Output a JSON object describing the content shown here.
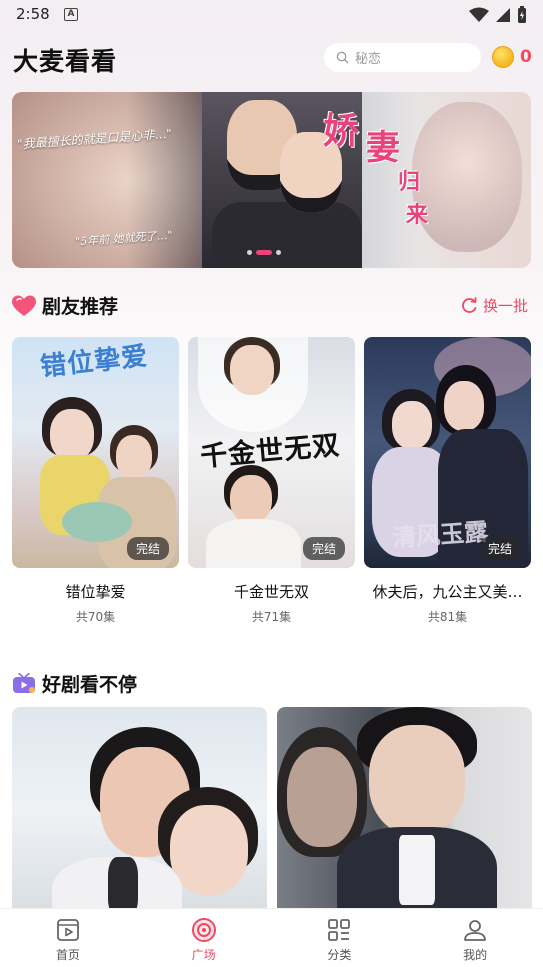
{
  "status_bar": {
    "time": "2:58",
    "notification_letter": "A"
  },
  "header": {
    "title": "大麦看看",
    "search_placeholder": "秘恋",
    "coin_count": "0"
  },
  "banner": {
    "caption_1": "\"我最擅长的就是口是心非…\"",
    "caption_2": "\"5年前 她就死了…\"",
    "title_chars": [
      "娇",
      "妻",
      "归",
      "来"
    ],
    "active_slide": 1,
    "slide_count": 3
  },
  "recommend": {
    "title": "剧友推荐",
    "refresh_label": "换一批",
    "items": [
      {
        "name": "错位挚爱",
        "episodes": "共70集",
        "badge": "完结",
        "poster_text": "错位挚爱"
      },
      {
        "name": "千金世无双",
        "episodes": "共71集",
        "badge": "完结",
        "poster_text": "千金世无双"
      },
      {
        "name": "休夫后，九公主又美…",
        "episodes": "共81集",
        "badge": "完结",
        "poster_text": "清风玉露"
      }
    ]
  },
  "nonstop": {
    "title": "好剧看不停"
  },
  "bottom_nav": {
    "items": [
      {
        "label": "首页",
        "icon": "play-box-icon",
        "active": false
      },
      {
        "label": "广场",
        "icon": "disc-icon",
        "active": true
      },
      {
        "label": "分类",
        "icon": "grid-icon",
        "active": false
      },
      {
        "label": "我的",
        "icon": "user-icon",
        "active": false
      }
    ]
  },
  "colors": {
    "accent": "#ef4a62",
    "coin": "#f4b51b"
  }
}
